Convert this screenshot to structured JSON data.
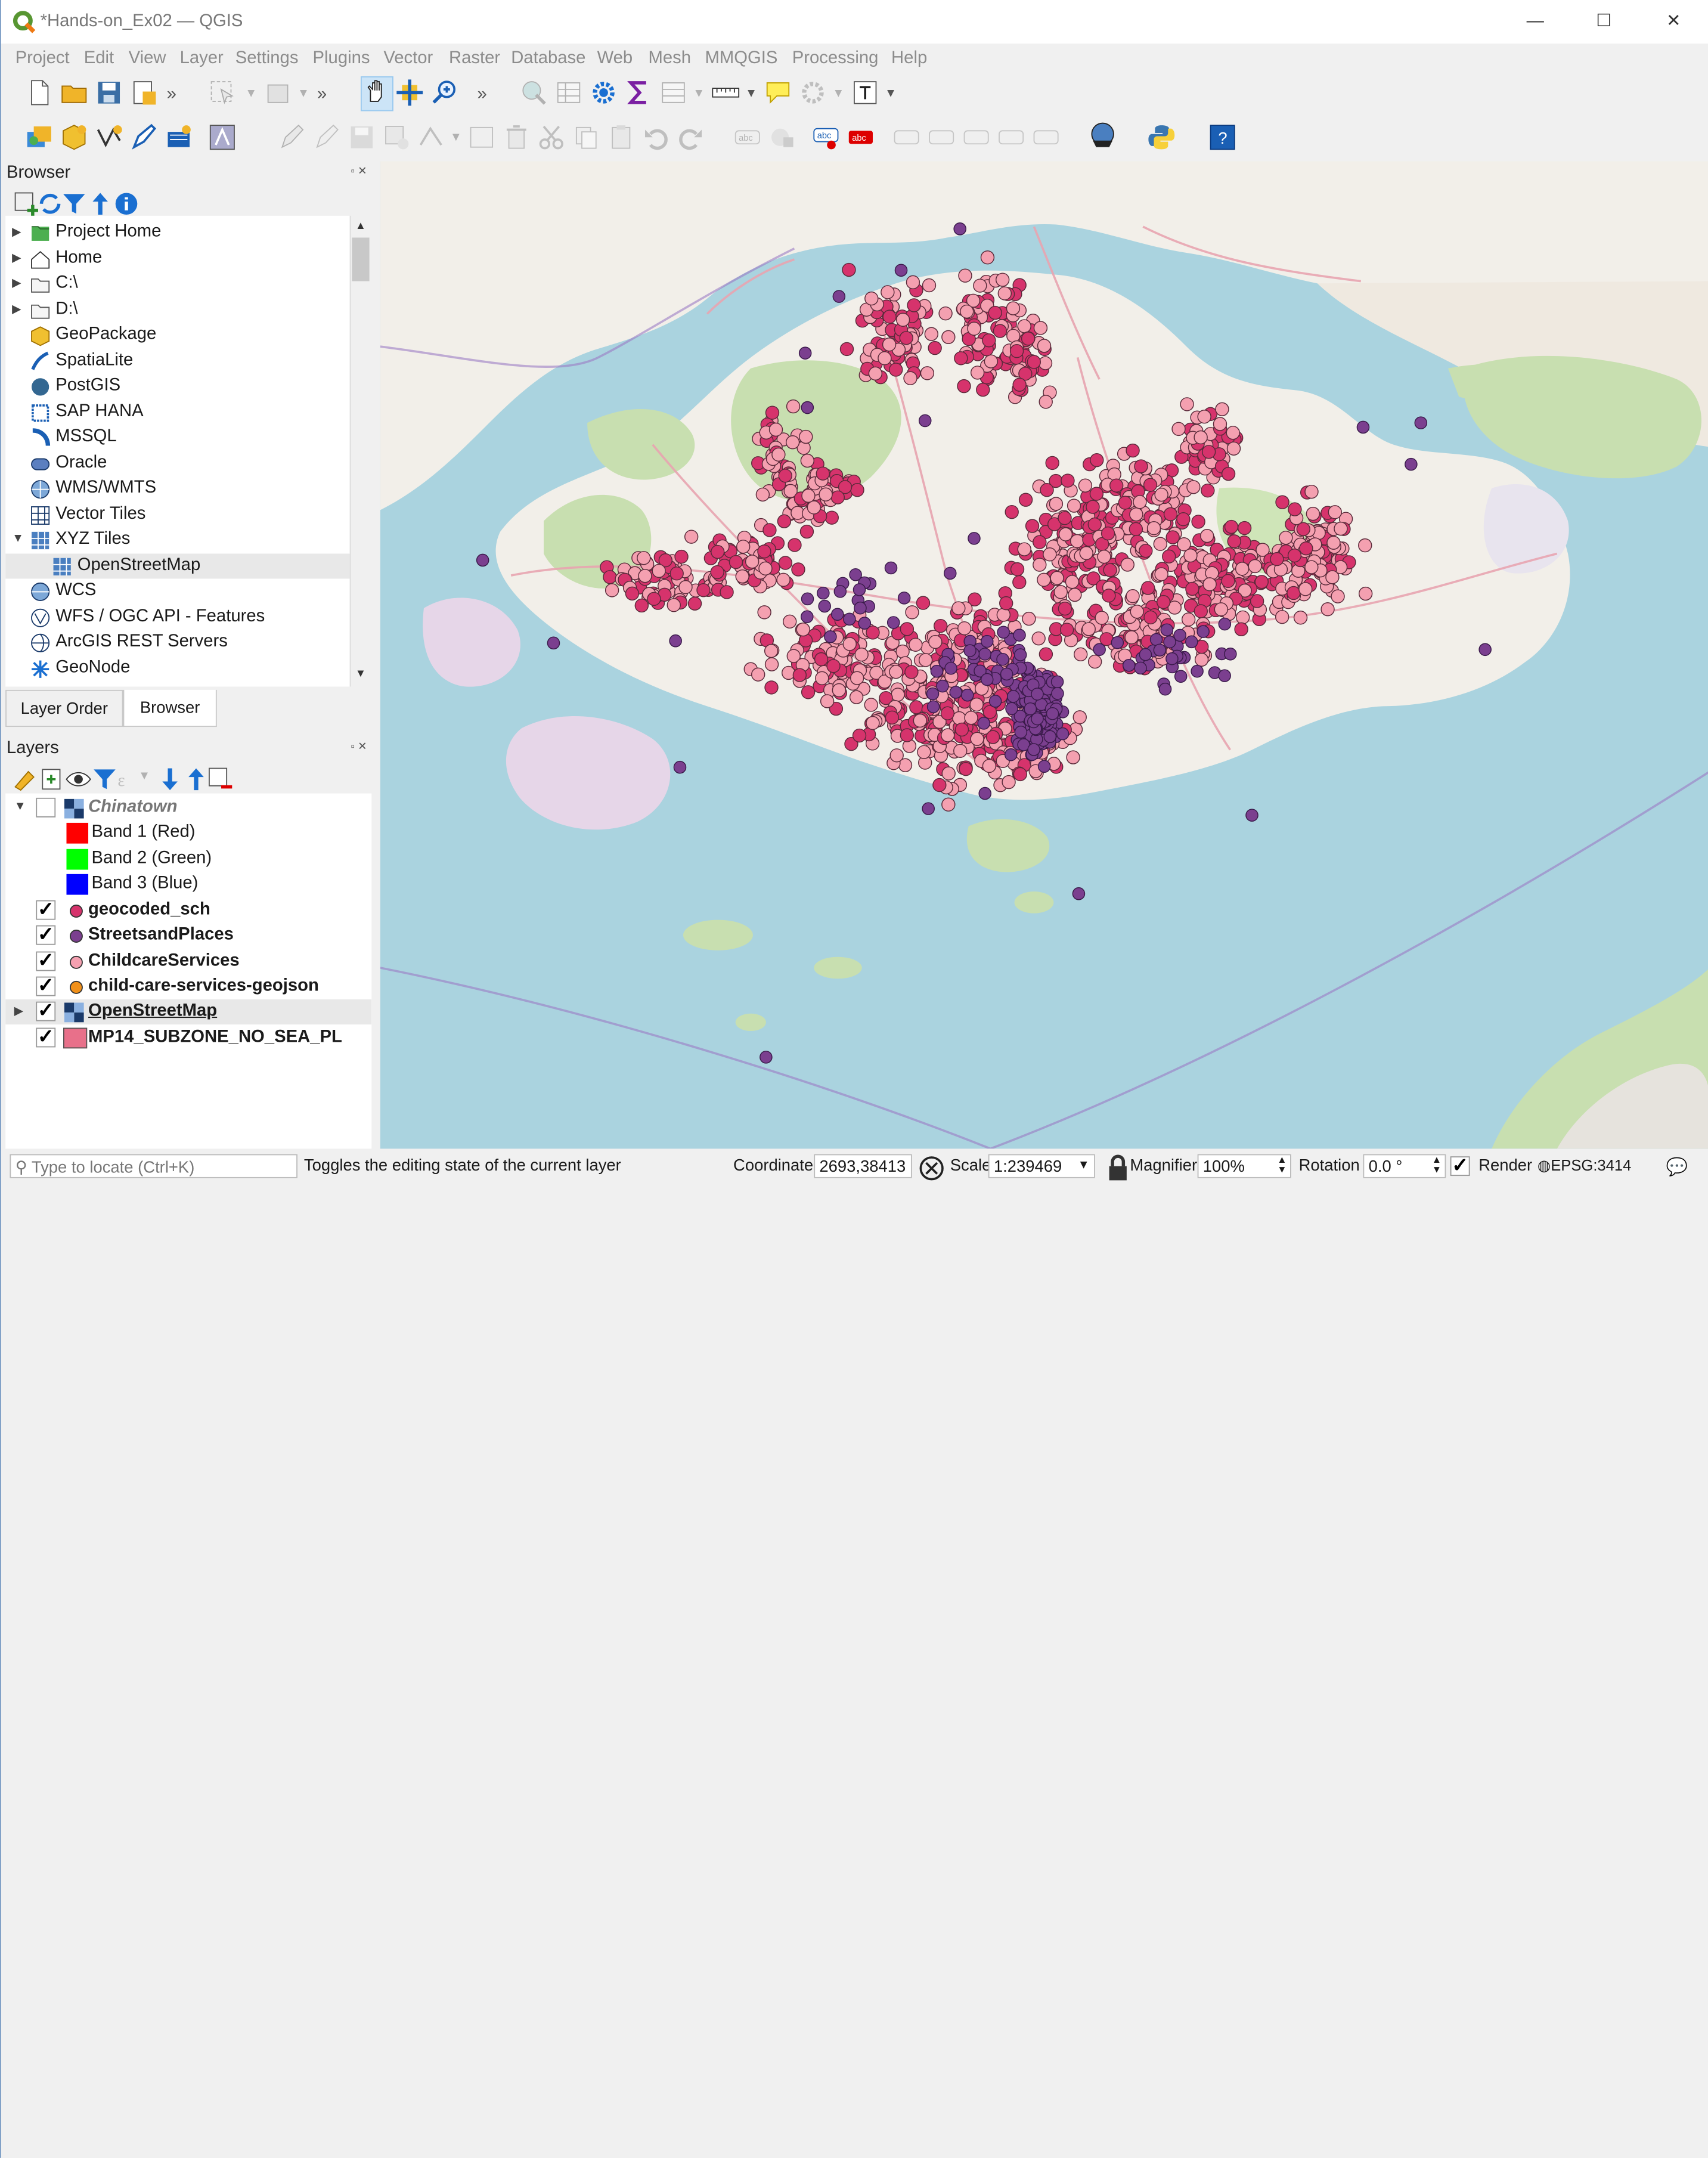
{
  "window": {
    "title": "*Hands-on_Ex02 — QGIS",
    "minimize": "—",
    "maximize": "☐",
    "close": "✕"
  },
  "menu": [
    "Project",
    "Edit",
    "View",
    "Layer",
    "Settings",
    "Plugins",
    "Vector",
    "Raster",
    "Database",
    "Web",
    "Mesh",
    "MMQGIS",
    "Processing",
    "Help"
  ],
  "browser": {
    "title": "Browser",
    "items": [
      {
        "label": "Project Home",
        "icon": "project-home-icon"
      },
      {
        "label": "Home",
        "icon": "home-folder-icon"
      },
      {
        "label": "C:\\",
        "icon": "drive-icon"
      },
      {
        "label": "D:\\",
        "icon": "drive-icon"
      },
      {
        "label": "GeoPackage",
        "icon": "geopackage-icon"
      },
      {
        "label": "SpatiaLite",
        "icon": "spatialite-icon"
      },
      {
        "label": "PostGIS",
        "icon": "postgis-icon"
      },
      {
        "label": "SAP HANA",
        "icon": "sap-hana-icon"
      },
      {
        "label": "MSSQL",
        "icon": "mssql-icon"
      },
      {
        "label": "Oracle",
        "icon": "oracle-icon"
      },
      {
        "label": "WMS/WMTS",
        "icon": "wms-icon"
      },
      {
        "label": "Vector Tiles",
        "icon": "vector-tiles-icon"
      },
      {
        "label": "XYZ Tiles",
        "icon": "xyz-tiles-icon"
      },
      {
        "label": "OpenStreetMap",
        "icon": "xyz-tiles-icon"
      },
      {
        "label": "WCS",
        "icon": "wcs-icon"
      },
      {
        "label": "WFS / OGC API - Features",
        "icon": "wfs-icon"
      },
      {
        "label": "ArcGIS REST Servers",
        "icon": "arcgis-icon"
      },
      {
        "label": "GeoNode",
        "icon": "geonode-icon"
      }
    ]
  },
  "tabs": [
    "Layer Order",
    "Browser"
  ],
  "layers": {
    "title": "Layers",
    "items": [
      {
        "name": "Chinatown",
        "checked": false
      },
      {
        "name": "Band 1 (Red)",
        "color": "#ff0000"
      },
      {
        "name": "Band 2 (Green)",
        "color": "#00ff00"
      },
      {
        "name": "Band 3 (Blue)",
        "color": "#0000ff"
      },
      {
        "name": "geocoded_sch",
        "checked": true,
        "color": "#d6336c"
      },
      {
        "name": "StreetsandPlaces",
        "checked": true,
        "color": "#7b3f8f"
      },
      {
        "name": "ChildcareServices",
        "checked": true,
        "color": "#f4a0b0"
      },
      {
        "name": "child-care-services-geojson",
        "checked": true,
        "color": "#f0901a"
      },
      {
        "name": "OpenStreetMap",
        "checked": true
      },
      {
        "name": "MP14_SUBZONE_NO_SEA_PL",
        "checked": true,
        "color": "#e8708a"
      }
    ]
  },
  "status": {
    "locator_placeholder": "Type to locate (Ctrl+K)",
    "message": "Toggles the editing state of the current layer",
    "coordinate_label": "Coordinate",
    "coordinate": "2693,38413",
    "scale_label": "Scale",
    "scale": "1:239469",
    "magnifier_label": "Magnifier",
    "magnifier": "100%",
    "rotation_label": "Rotation",
    "rotation": "0.0 °",
    "render_label": "Render",
    "crs": "EPSG:3414"
  },
  "colors": {
    "school": "#d6336c",
    "streets": "#7b3f8f",
    "childcare": "#f4a0b0",
    "sea": "#aad3df",
    "land": "#f2efe9",
    "park": "#c8dfb0"
  }
}
